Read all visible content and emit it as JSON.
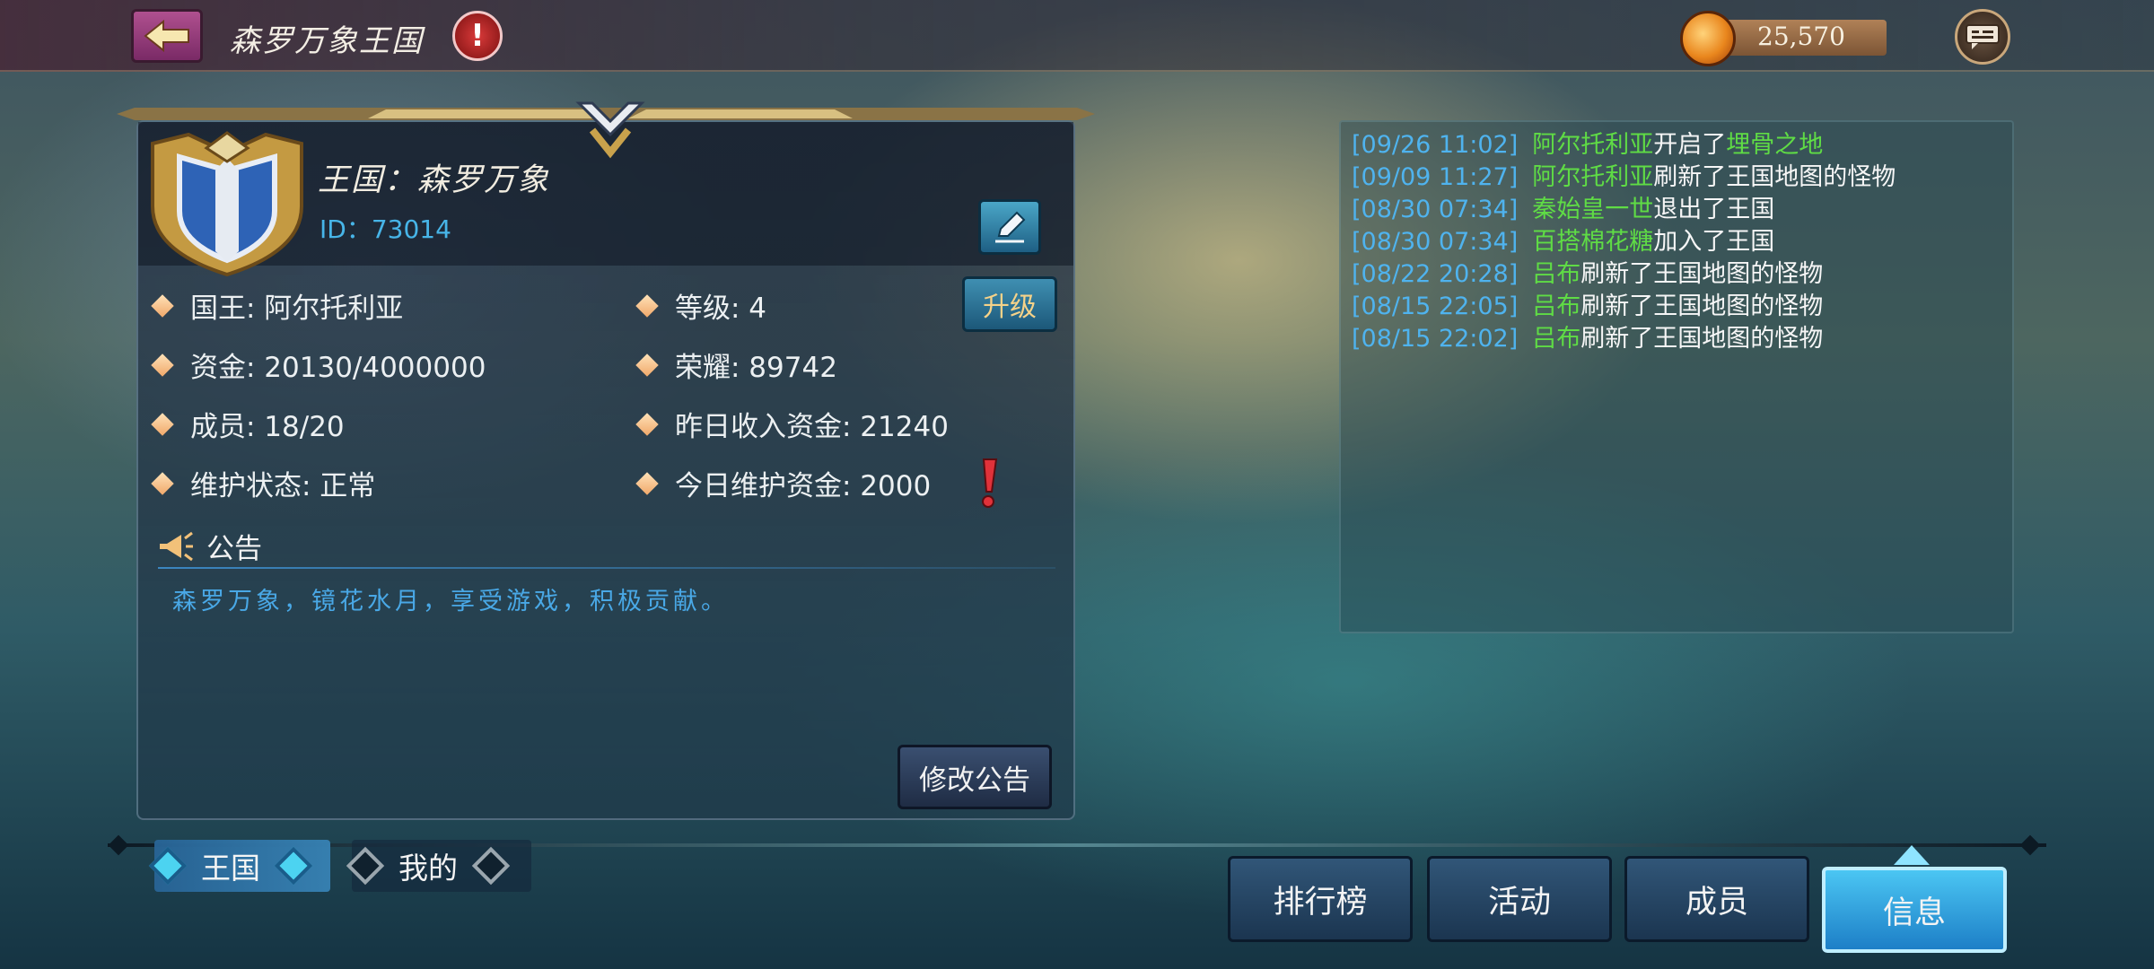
{
  "header": {
    "title": "森罗万象王国",
    "alert_symbol": "!",
    "currency": "25,570",
    "icons": [
      "back-arrow-icon",
      "alert-icon",
      "coin-icon",
      "chat-icon"
    ]
  },
  "kingdom": {
    "name": "王国：森罗万象",
    "id": "ID：73014",
    "upgrade_label": "升级",
    "stats": {
      "king": "国王: 阿尔托利亚",
      "level": "等级: 4",
      "funds": "资金: 20130/4000000",
      "glory": "荣耀: 89742",
      "members": "成员: 18/20",
      "yesterday_income": "昨日收入资金: 21240",
      "maintenance_status": "维护状态: 正常",
      "today_maintenance": "今日维护资金: 2000"
    },
    "notice_title": "公告",
    "notice_text": "森罗万象，镜花水月，享受游戏，积极贡献。",
    "modify_label": "修改公告"
  },
  "log": [
    {
      "time": "[09/26 11:02]",
      "name": "阿尔托利亚",
      "action": "开启了",
      "place": "埋骨之地"
    },
    {
      "time": "[09/09 11:27]",
      "name": "阿尔托利亚",
      "action": "刷新了王国地图的怪物",
      "place": ""
    },
    {
      "time": "[08/30 07:34]",
      "name": "秦始皇一世",
      "action": "退出了王国",
      "place": ""
    },
    {
      "time": "[08/30 07:34]",
      "name": "百搭棉花糖",
      "action": "加入了王国",
      "place": ""
    },
    {
      "time": "[08/22 20:28]",
      "name": "吕布",
      "action": "刷新了王国地图的怪物",
      "place": ""
    },
    {
      "time": "[08/15 22:05]",
      "name": "吕布",
      "action": "刷新了王国地图的怪物",
      "place": ""
    },
    {
      "time": "[08/15 22:02]",
      "name": "吕布",
      "action": "刷新了王国地图的怪物",
      "place": ""
    }
  ],
  "tabs": {
    "kingdom": "王国",
    "mine": "我的"
  },
  "nav": {
    "ranking": "排行榜",
    "activity": "活动",
    "members": "成员",
    "info": "信息"
  },
  "colors": {
    "log_time": "#4fb3ee",
    "log_name": "#5fdc45",
    "notice_text": "#49a8e6",
    "upgrade_text": "#f5d289"
  }
}
